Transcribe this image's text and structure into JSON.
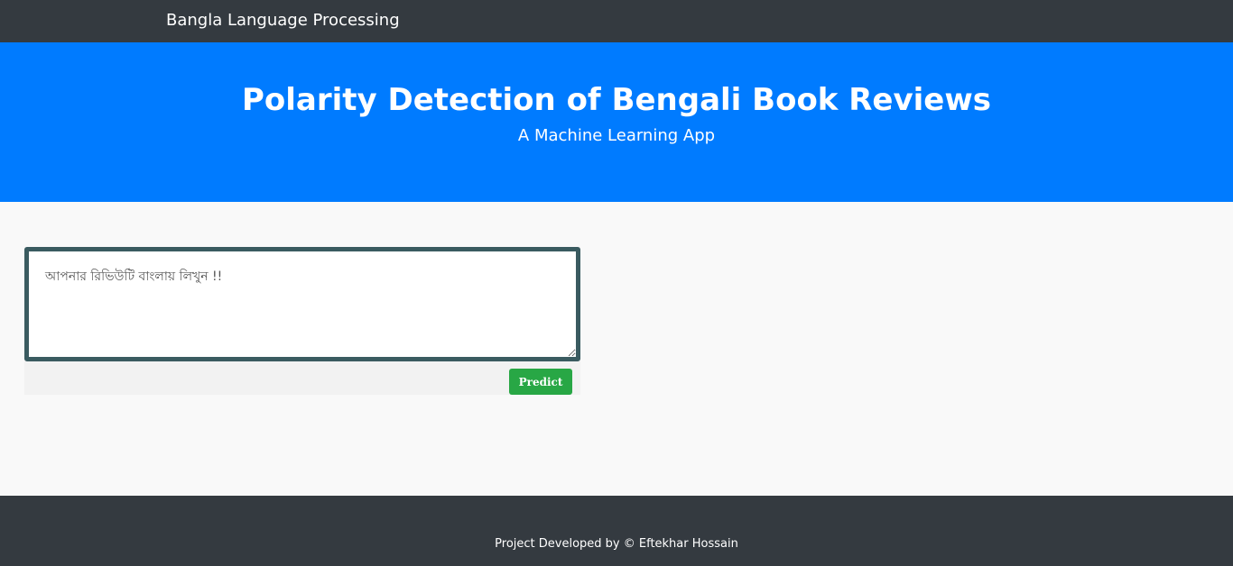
{
  "navbar": {
    "brand": "Bangla Language Processing"
  },
  "hero": {
    "title": "Polarity Detection of Bengali Book Reviews",
    "subtitle": "A Machine Learning App"
  },
  "form": {
    "review_placeholder": "আপনার রিভিউটি বাংলায় লিখুন !!",
    "review_value": "",
    "predict_label": "Predict"
  },
  "footer": {
    "credit": "Project Developed by © Eftekhar Hossain"
  },
  "colors": {
    "navbar_bg": "#343a40",
    "hero_bg": "#007bff",
    "input_border": "#3a5b60",
    "predict_button": "#28a745",
    "footer_bg": "#343a40"
  }
}
